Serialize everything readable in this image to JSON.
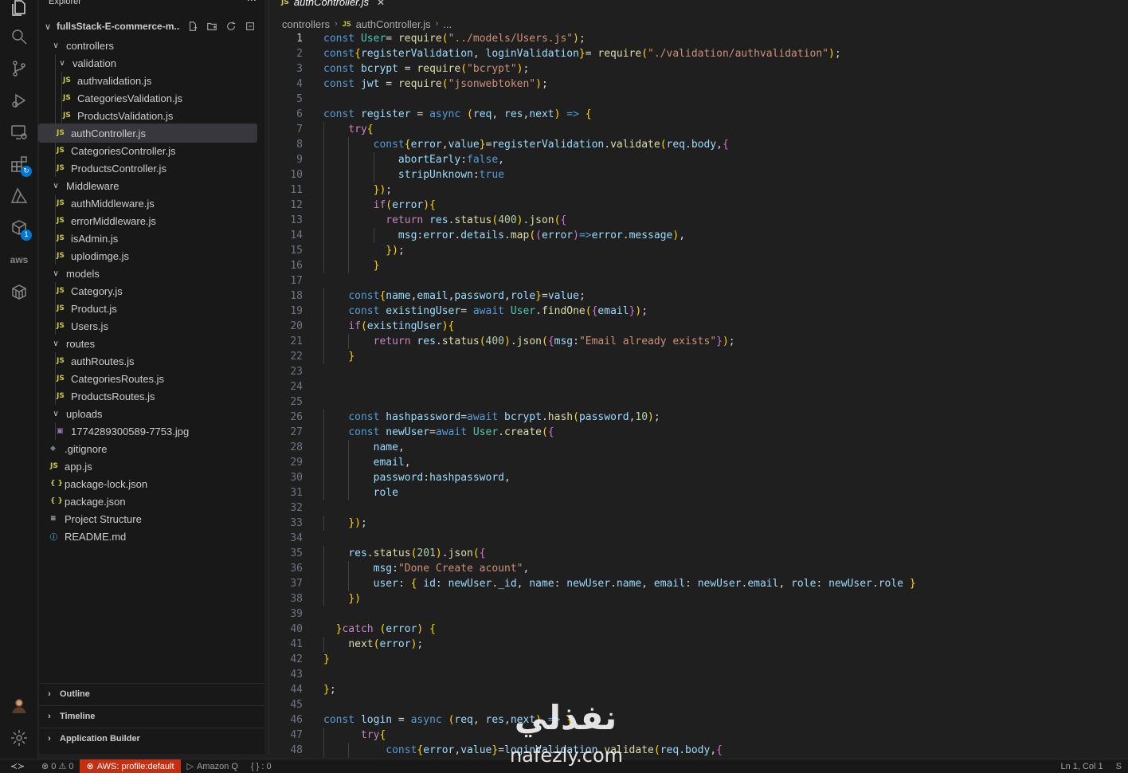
{
  "sidebar": {
    "title": "Explorer",
    "more": "···",
    "workspace": "fullsStack-E-commerce-m...",
    "tree": [
      {
        "label": "controllers",
        "type": "folder",
        "depth": 1
      },
      {
        "label": "validation",
        "type": "folder",
        "depth": 2
      },
      {
        "label": "authvalidation.js",
        "type": "js",
        "depth": 3
      },
      {
        "label": "CategoriesValidation.js",
        "type": "js",
        "depth": 3
      },
      {
        "label": "ProductsValidation.js",
        "type": "js",
        "depth": 3
      },
      {
        "label": "authController.js",
        "type": "js",
        "depth": 2,
        "selected": true
      },
      {
        "label": "CategoriesController.js",
        "type": "js",
        "depth": 2
      },
      {
        "label": "ProductsController.js",
        "type": "js",
        "depth": 2
      },
      {
        "label": "Middleware",
        "type": "folder",
        "depth": 1
      },
      {
        "label": "authMiddleware.js",
        "type": "js",
        "depth": 2
      },
      {
        "label": "errorMiddleware.js",
        "type": "js",
        "depth": 2
      },
      {
        "label": "isAdmin.js",
        "type": "js",
        "depth": 2
      },
      {
        "label": "uplodimge.js",
        "type": "js",
        "depth": 2
      },
      {
        "label": "models",
        "type": "folder",
        "depth": 1
      },
      {
        "label": "Category.js",
        "type": "js",
        "depth": 2
      },
      {
        "label": "Product.js",
        "type": "js",
        "depth": 2
      },
      {
        "label": "Users.js",
        "type": "js",
        "depth": 2
      },
      {
        "label": "routes",
        "type": "folder",
        "depth": 1
      },
      {
        "label": "authRoutes.js",
        "type": "js",
        "depth": 2
      },
      {
        "label": "CategoriesRoutes.js",
        "type": "js",
        "depth": 2
      },
      {
        "label": "ProductsRoutes.js",
        "type": "js",
        "depth": 2
      },
      {
        "label": "uploads",
        "type": "folder",
        "depth": 1
      },
      {
        "label": "1774289300589-7753.jpg",
        "type": "img",
        "depth": 2
      },
      {
        "label": ".gitignore",
        "type": "git",
        "depth": 1
      },
      {
        "label": "app.js",
        "type": "js",
        "depth": 1
      },
      {
        "label": "package-lock.json",
        "type": "json",
        "depth": 1
      },
      {
        "label": "package.json",
        "type": "json",
        "depth": 1
      },
      {
        "label": "Project Structure",
        "type": "txt",
        "depth": 1
      },
      {
        "label": "README.md",
        "type": "info",
        "depth": 1
      }
    ],
    "panels": [
      "Outline",
      "Timeline",
      "Application Builder"
    ]
  },
  "editor": {
    "tab_label": "authController.js",
    "breadcrumb": [
      "controllers",
      "authController.js",
      "..."
    ],
    "lines": [
      "const User= require(\"../models/Users.js\");",
      "const{registerValidation, loginValidation}= require(\"./validation/authvalidation\");",
      "const bcrypt = require(\"bcrypt\");",
      "const jwt = require(\"jsonwebtoken\");",
      "",
      "const register = async (req, res,next) => {",
      "    try{",
      "        const{error,value}=registerValidation.validate(req.body,{",
      "            abortEarly:false,",
      "            stripUnknown:true",
      "        });",
      "        if(error){",
      "          return res.status(400).json({",
      "            msg:error.details.map((error)=>error.message),",
      "          });",
      "        }",
      "",
      "    const{name,email,password,role}=value;",
      "    const existingUser= await User.findOne({email});",
      "    if(existingUser){",
      "        return res.status(400).json({msg:\"Email already exists\"});",
      "    }",
      "",
      "",
      "",
      "    const hashpassword=await bcrypt.hash(password,10);",
      "    const newUser=await User.create({",
      "        name,",
      "        email,",
      "        password:hashpassword,",
      "        role",
      "",
      "    });",
      "",
      "    res.status(201).json({",
      "        msg:\"Done Create acount\",",
      "        user: { id: newUser._id, name: newUser.name, email: newUser.email, role: newUser.role }",
      "    })",
      "",
      "  }catch (error) {",
      "    next(error);",
      "}",
      "",
      "};",
      "",
      "const login = async (req, res,next) => {",
      "      try{",
      "          const{error,value}=loginValidation.validate(req.body,{"
    ]
  },
  "statusbar": {
    "problems": "⊗ 0 ⚠ 0",
    "aws_profile": "AWS: profile:default",
    "amazon_q": "Amazon Q",
    "braces": "{ } : 0",
    "cursor": "Ln 1, Col 1",
    "spaces": "S"
  },
  "watermark": {
    "arabic": "نفذلي",
    "latin": "nafezly.com"
  }
}
